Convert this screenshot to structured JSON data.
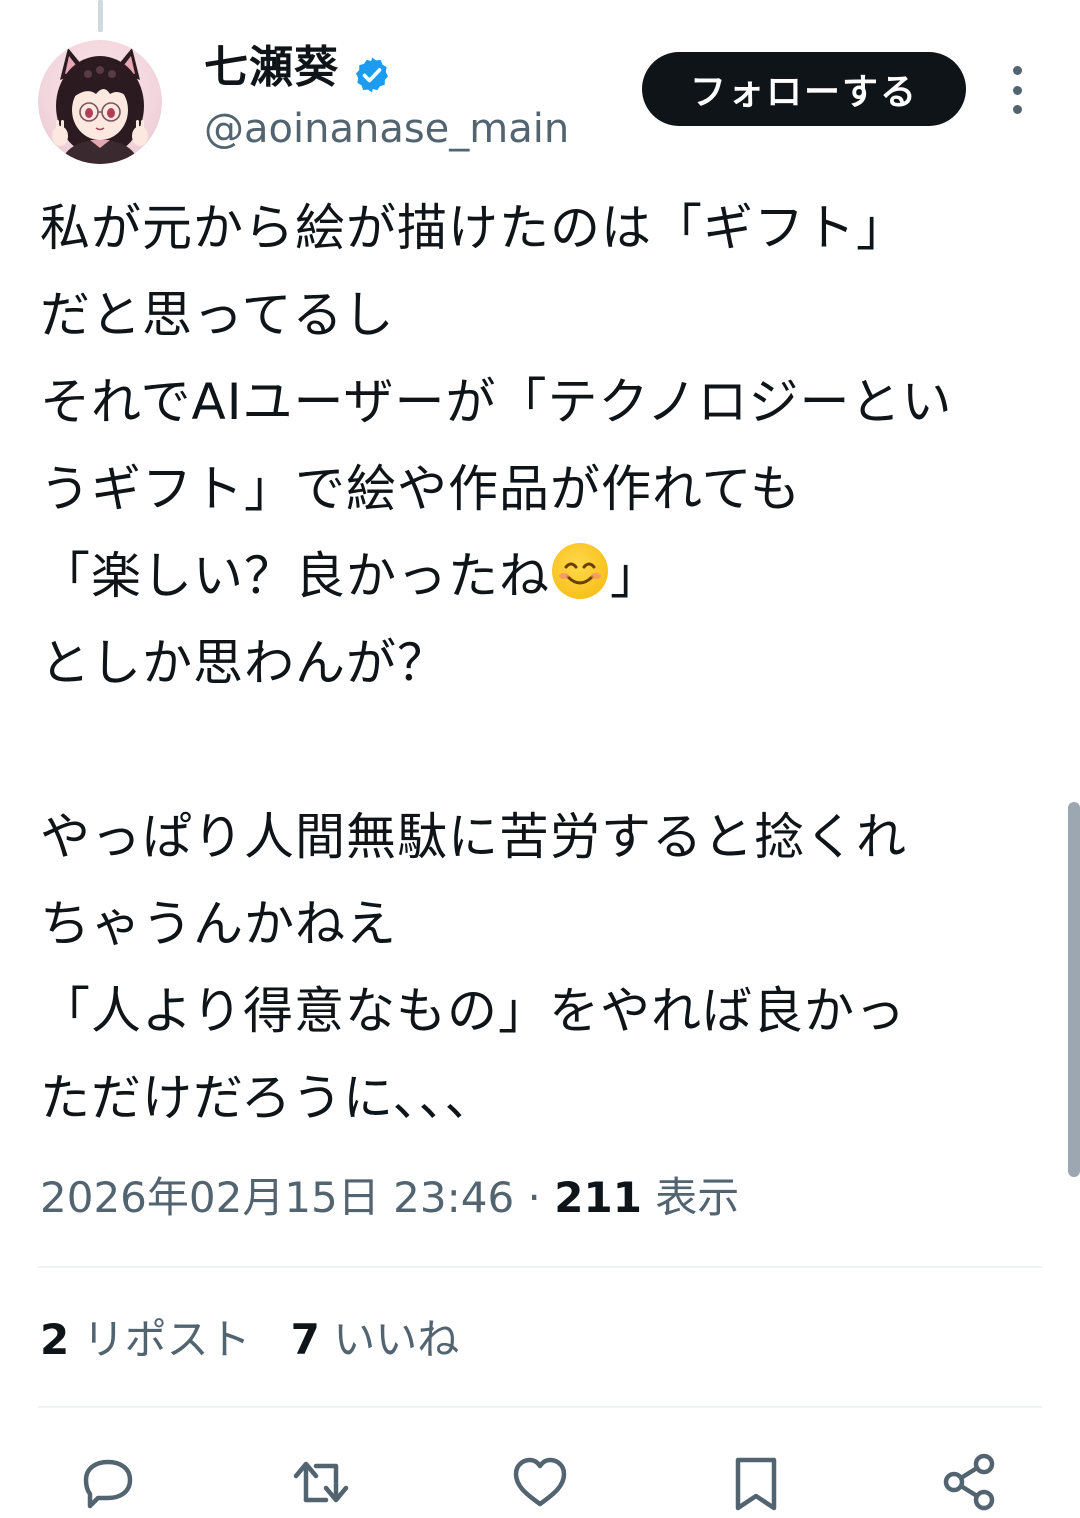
{
  "author": {
    "display_name": "七瀬葵",
    "handle": "@aoinanase_main",
    "verified": true
  },
  "follow_button": {
    "label": "フォローする"
  },
  "tweet": {
    "lines": [
      "私が元から絵が描けたのは「ギフト」",
      "だと思ってるし",
      "それでAIユーザーが「テクノロジーとい",
      "うギフト」で絵や作品が作れても",
      "「楽しい？良かったね",
      "」",
      "としか思わんが？",
      "やっぱり人間無駄に苦労すると捻くれ",
      "ちゃうんかねえ",
      "「人より得意なもの」をやれば良かっ",
      "ただけだろうに、、、"
    ]
  },
  "meta": {
    "timestamp": "2026年02月15日 23:46",
    "separator": "·",
    "views_count": "211",
    "views_label": "表示"
  },
  "stats": {
    "reposts_count": "2",
    "reposts_label": "リポスト",
    "likes_count": "7",
    "likes_label": "いいね"
  },
  "colors": {
    "text": "#0f1419",
    "secondary": "#536471",
    "verified": "#1d9bf0",
    "button_bg": "#0f1419"
  },
  "icons": [
    "reply-icon",
    "retweet-icon",
    "like-icon",
    "bookmark-icon",
    "share-icon"
  ]
}
